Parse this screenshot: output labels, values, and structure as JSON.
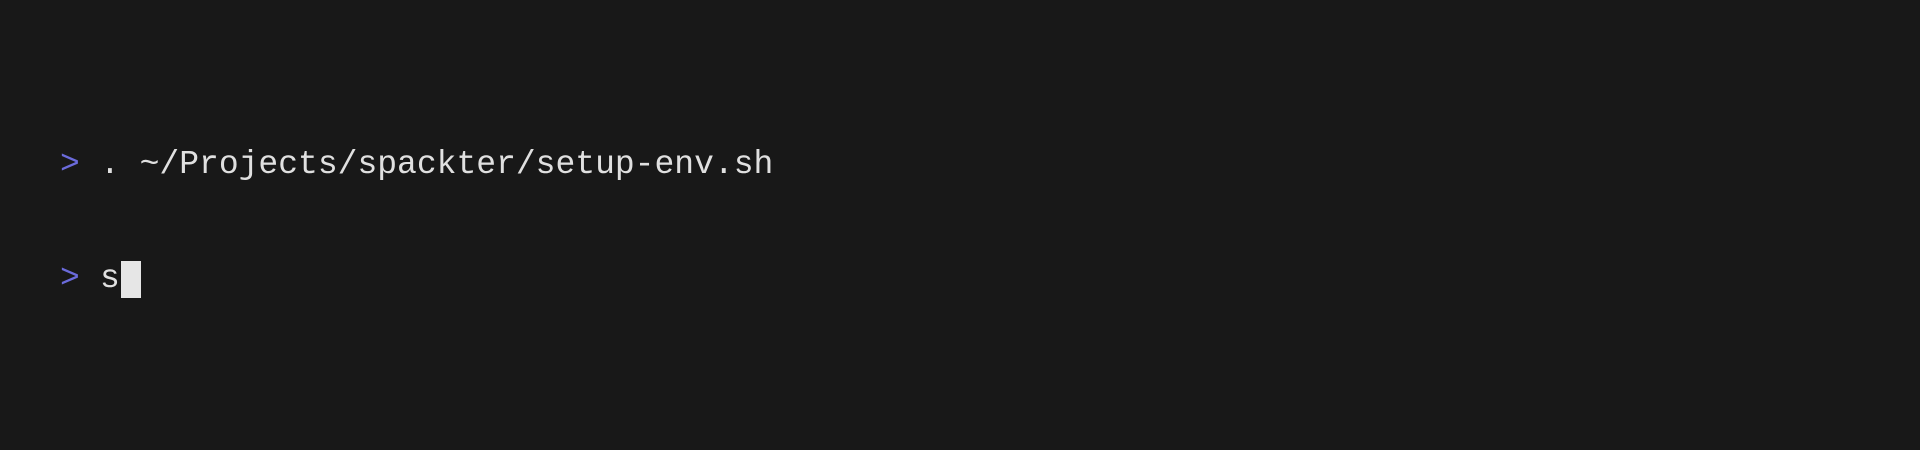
{
  "terminal": {
    "lines": [
      {
        "prompt": ">",
        "command": ". ~/Projects/spackter/setup-env.sh"
      },
      {
        "prompt": ">",
        "command": "s"
      }
    ]
  },
  "colors": {
    "background": "#181818",
    "prompt": "#6b6bdb",
    "text": "#e0e0e0",
    "cursor": "#e6e6e6"
  }
}
